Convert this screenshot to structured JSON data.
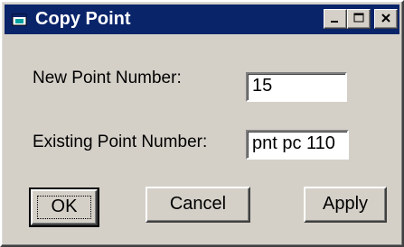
{
  "window": {
    "title": "Copy Point",
    "icon": "app-window-icon",
    "controls": {
      "minimize": "minimize-icon",
      "maximize": "maximize-icon",
      "close": "close-icon"
    }
  },
  "form": {
    "new_point_label": "New Point Number:",
    "new_point_value": "15",
    "existing_point_label": "Existing Point Number:",
    "existing_point_value": "pnt pc 110"
  },
  "buttons": {
    "ok": "OK",
    "cancel": "Cancel",
    "apply": "Apply"
  },
  "colors": {
    "titlebar": "#0a246a",
    "face": "#d4d0c8"
  }
}
